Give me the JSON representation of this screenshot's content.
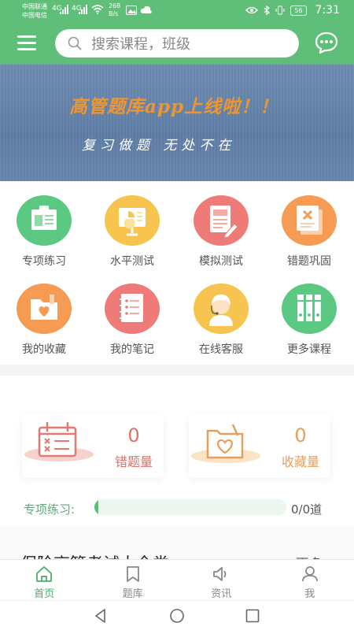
{
  "status_bar": {
    "carrier_1": "中国联通",
    "carrier_2": "中国电信",
    "signal_1": "4G",
    "signal_2": "4G",
    "net_speed_value": "268",
    "net_speed_unit": "B/s",
    "battery": "56",
    "time": "7:31"
  },
  "header": {
    "search_placeholder": "搜索课程，班级"
  },
  "banner": {
    "title": "高管题库app上线啦！！",
    "subtitle": "复习做题 无处不在"
  },
  "grid": [
    {
      "label": "专项练习",
      "icon": "board-icon",
      "color": "#5cc983"
    },
    {
      "label": "水平测试",
      "icon": "presentation-chart-icon",
      "color": "#f6c44f"
    },
    {
      "label": "模拟测试",
      "icon": "document-edit-icon",
      "color": "#ef7b78"
    },
    {
      "label": "错题巩固",
      "icon": "wrong-answer-icon",
      "color": "#f59b53"
    },
    {
      "label": "我的收藏",
      "icon": "heart-folder-icon",
      "color": "#f59b53"
    },
    {
      "label": "我的笔记",
      "icon": "notes-list-icon",
      "color": "#ef7b78"
    },
    {
      "label": "在线客服",
      "icon": "customer-service-icon",
      "color": "#f6c44f"
    },
    {
      "label": "更多课程",
      "icon": "binders-icon",
      "color": "#5cc983"
    }
  ],
  "stats": {
    "wrong": {
      "value": "0",
      "label": "错题量",
      "color": "#d9736a"
    },
    "favorites": {
      "value": "0",
      "label": "收藏量",
      "color": "#e3a15c"
    }
  },
  "practice": {
    "label": "专项练习:",
    "progress": 0.02,
    "value": "0/0道"
  },
  "course_section": {
    "title": "保险高管考试大全类",
    "more": "更多>"
  },
  "bottom_nav": [
    {
      "label": "首页",
      "icon": "home-icon",
      "active": true
    },
    {
      "label": "题库",
      "icon": "bookmark-icon",
      "active": false
    },
    {
      "label": "资讯",
      "icon": "speaker-icon",
      "active": false
    },
    {
      "label": "我",
      "icon": "user-icon",
      "active": false
    }
  ],
  "colors": {
    "brand": "#5fbf78",
    "nav_active": "#4caf6a",
    "nav_inactive": "#888888"
  }
}
